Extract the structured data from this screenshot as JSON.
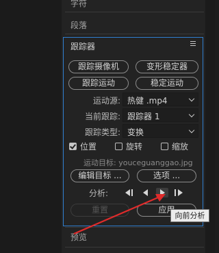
{
  "sections": {
    "character": "字符",
    "paragraph": "段落",
    "preview": "预览"
  },
  "tracker": {
    "title": "跟踪器",
    "buttons": {
      "track_camera": "跟踪摄像机",
      "warp_stabilizer": "变形稳定器",
      "track_motion": "跟踪运动",
      "stabilize_motion": "稳定运动"
    },
    "motion_source": {
      "label": "运动源:",
      "value": "热健 .mp4"
    },
    "current_track": {
      "label": "当前跟踪:",
      "value": "跟踪器 1"
    },
    "track_type": {
      "label": "跟踪类型:",
      "value": "变换"
    },
    "checkboxes": {
      "position": {
        "label": "位置",
        "checked": true
      },
      "rotation": {
        "label": "旋转",
        "checked": false
      },
      "scale": {
        "label": "缩放",
        "checked": false
      }
    },
    "motion_target": "运动目标: youceguanggao.jpg",
    "edit_target": "编辑目标 ...",
    "options": "选项 ...",
    "analyze_label": "分析:",
    "reset": "重置",
    "apply": "应用"
  },
  "tooltip": "向前分析",
  "colors": {
    "focus_border": "#2f7fd0",
    "arrow": "#e02b2b"
  }
}
